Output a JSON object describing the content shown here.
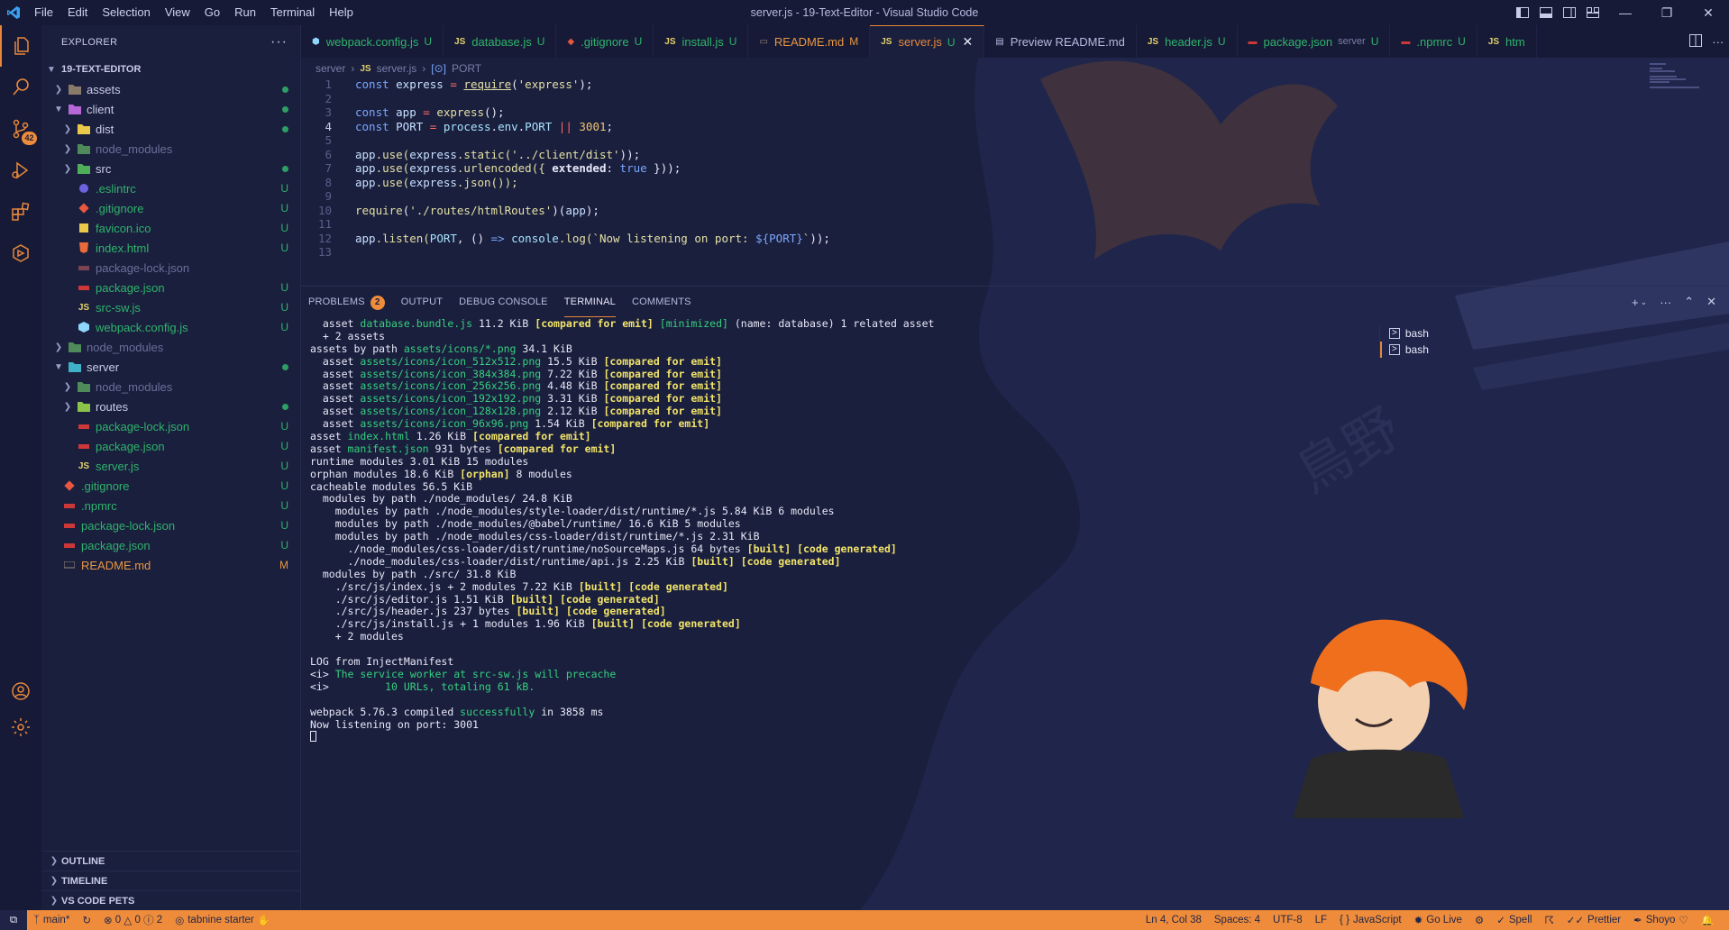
{
  "app": {
    "window_title": "server.js - 19-Text-Editor - Visual Studio Code"
  },
  "menu": [
    "File",
    "Edit",
    "Selection",
    "View",
    "Go",
    "Run",
    "Terminal",
    "Help"
  ],
  "activity": {
    "source_control_badge": "42"
  },
  "sidebar": {
    "title": "EXPLORER",
    "more": "···",
    "root": "19-TEXT-EDITOR",
    "items": [
      {
        "label": "assets",
        "status": "dot"
      },
      {
        "label": "client",
        "status": "dot"
      },
      {
        "label": "dist",
        "status": "dot"
      },
      {
        "label": "node_modules",
        "status": ""
      },
      {
        "label": "src",
        "status": "dot"
      },
      {
        "label": ".eslintrc",
        "status": "U"
      },
      {
        "label": ".gitignore",
        "status": "U"
      },
      {
        "label": "favicon.ico",
        "status": "U"
      },
      {
        "label": "index.html",
        "status": "U"
      },
      {
        "label": "package-lock.json",
        "status": ""
      },
      {
        "label": "package.json",
        "status": "U"
      },
      {
        "label": "src-sw.js",
        "status": "U"
      },
      {
        "label": "webpack.config.js",
        "status": "U"
      },
      {
        "label": "node_modules",
        "status": ""
      },
      {
        "label": "server",
        "status": "dot"
      },
      {
        "label": "node_modules",
        "status": ""
      },
      {
        "label": "routes",
        "status": "dot"
      },
      {
        "label": "package-lock.json",
        "status": "U"
      },
      {
        "label": "package.json",
        "status": "U"
      },
      {
        "label": "server.js",
        "status": "U"
      },
      {
        "label": ".gitignore",
        "status": "U"
      },
      {
        "label": ".npmrc",
        "status": "U"
      },
      {
        "label": "package-lock.json",
        "status": "U"
      },
      {
        "label": "package.json",
        "status": "U"
      },
      {
        "label": "README.md",
        "status": "M"
      }
    ],
    "sections": [
      "OUTLINE",
      "TIMELINE",
      "VS CODE PETS"
    ]
  },
  "tabs": [
    {
      "label": "webpack.config.js",
      "icon": "webpack-icon",
      "status": "U"
    },
    {
      "label": "database.js",
      "icon": "js-icon",
      "status": "U"
    },
    {
      "label": ".gitignore",
      "icon": "git-icon",
      "status": "U"
    },
    {
      "label": "install.js",
      "icon": "js-icon",
      "status": "U"
    },
    {
      "label": "README.md",
      "icon": "markdown-icon",
      "status": "M"
    },
    {
      "label": "server.js",
      "icon": "js-icon",
      "status": "U"
    },
    {
      "label": "Preview README.md",
      "icon": "preview-icon",
      "status": ""
    },
    {
      "label": "header.js",
      "icon": "js-icon",
      "status": "U"
    },
    {
      "label": "package.json",
      "icon": "npm-icon",
      "status": "U",
      "desc": "server"
    },
    {
      "label": ".npmrc",
      "icon": "npm-icon",
      "status": "U"
    },
    {
      "label": "htm",
      "icon": "js-icon",
      "status": ""
    }
  ],
  "breadcrumb": [
    "server",
    "server.js",
    "PORT"
  ],
  "code": {
    "line_numbers": [
      "1",
      "2",
      "3",
      "4",
      "5",
      "6",
      "7",
      "8",
      "9",
      "10",
      "11",
      "12",
      "13"
    ],
    "lines": {
      "l1_a": "const ",
      "l1_b": "express",
      "l1_c": " = ",
      "l1_d": "require",
      "l1_e": "(",
      "l1_f": "'express'",
      "l1_g": ");",
      "l3_a": "const ",
      "l3_b": "app",
      "l3_c": " = ",
      "l3_d": "express",
      "l3_e": "();",
      "l4_a": "const ",
      "l4_b": "PORT",
      "l4_c": " = ",
      "l4_d": "process",
      "l4_e": ".",
      "l4_f": "env",
      "l4_g": ".",
      "l4_h": "PORT",
      "l4_i": " || ",
      "l4_j": "3001",
      "l4_k": ";",
      "l6_a": "app",
      "l6_b": ".use(",
      "l6_c": "express",
      "l6_d": ".static(",
      "l6_e": "'../client/dist'",
      "l6_f": "));",
      "l7_a": "app",
      "l7_b": ".use(",
      "l7_c": "express",
      "l7_d": ".urlencoded({ ",
      "l7_e": "extended",
      "l7_f": ": ",
      "l7_g": "true",
      "l7_h": " }));",
      "l8_a": "app",
      "l8_b": ".use(",
      "l8_c": "express",
      "l8_d": ".json());",
      "l10_a": "require",
      "l10_b": "(",
      "l10_c": "'./routes/htmlRoutes'",
      "l10_d": ")(",
      "l10_e": "app",
      "l10_f": ");",
      "l12_a": "app",
      "l12_b": ".listen(",
      "l12_c": "PORT",
      "l12_d": ", () ",
      "l12_e": "=>",
      "l12_f": " console",
      "l12_g": ".log(",
      "l12_h": "`Now listening on port: ",
      "l12_i": "${PORT}",
      "l12_j": "`",
      "l12_k": "));"
    }
  },
  "panel": {
    "tabs": [
      "PROBLEMS",
      "OUTPUT",
      "DEBUG CONSOLE",
      "TERMINAL",
      "COMMENTS"
    ],
    "problems_count": "2",
    "terminals": [
      "bash",
      "bash"
    ]
  },
  "terminal": {
    "t1": [
      "  asset ",
      "database.bundle.js",
      " 11.2 KiB ",
      "[compared for emit]",
      " ",
      "[minimized]",
      " (name: database) 1 related asset"
    ],
    "t2": "  + 2 assets",
    "t3": [
      "assets by path ",
      "assets/icons/*.png",
      " 34.1 KiB"
    ],
    "icons": [
      [
        "  asset ",
        "assets/icons/icon_512x512.png",
        " 15.5 KiB ",
        "[compared for emit]"
      ],
      [
        "  asset ",
        "assets/icons/icon_384x384.png",
        " 7.22 KiB ",
        "[compared for emit]"
      ],
      [
        "  asset ",
        "assets/icons/icon_256x256.png",
        " 4.48 KiB ",
        "[compared for emit]"
      ],
      [
        "  asset ",
        "assets/icons/icon_192x192.png",
        " 3.31 KiB ",
        "[compared for emit]"
      ],
      [
        "  asset ",
        "assets/icons/icon_128x128.png",
        " 2.12 KiB ",
        "[compared for emit]"
      ],
      [
        "  asset ",
        "assets/icons/icon_96x96.png",
        " 1.54 KiB ",
        "[compared for emit]"
      ]
    ],
    "t10": [
      "asset ",
      "index.html",
      " 1.26 KiB ",
      "[compared for emit]"
    ],
    "t11": [
      "asset ",
      "manifest.json",
      " 931 bytes ",
      "[compared for emit]"
    ],
    "t12": "runtime modules 3.01 KiB 15 modules",
    "t13": [
      "orphan modules 18.6 KiB ",
      "[orphan]",
      " 8 modules"
    ],
    "t14": "cacheable modules 56.5 KiB",
    "t15": "  modules by path ./node_modules/ 24.8 KiB",
    "t16": "    modules by path ./node_modules/style-loader/dist/runtime/*.js 5.84 KiB 6 modules",
    "t17": "    modules by path ./node_modules/@babel/runtime/ 16.6 KiB 5 modules",
    "t18": "    modules by path ./node_modules/css-loader/dist/runtime/*.js 2.31 KiB",
    "t19": [
      "      ./node_modules/css-loader/dist/runtime/noSourceMaps.js 64 bytes ",
      "[built]",
      " ",
      "[code generated]"
    ],
    "t20": [
      "      ./node_modules/css-loader/dist/runtime/api.js 2.25 KiB ",
      "[built]",
      " ",
      "[code generated]"
    ],
    "t21": "  modules by path ./src/ 31.8 KiB",
    "t22": [
      "    ./src/js/index.js + 2 modules 7.22 KiB ",
      "[built]",
      " ",
      "[code generated]"
    ],
    "t23": [
      "    ./src/js/editor.js 1.51 KiB ",
      "[built]",
      " ",
      "[code generated]"
    ],
    "t24": [
      "    ./src/js/header.js 237 bytes ",
      "[built]",
      " ",
      "[code generated]"
    ],
    "t25": [
      "    ./src/js/install.js + 1 modules 1.96 KiB ",
      "[built]",
      " ",
      "[code generated]"
    ],
    "t26": "    + 2 modules",
    "t28": "LOG from InjectManifest",
    "t29": [
      "<i> ",
      "The service worker at src-sw.js will precache"
    ],
    "t30": [
      "<i>         ",
      "10 URLs, totaling 61 kB."
    ],
    "t32": [
      "webpack 5.76.3 compiled ",
      "successfully",
      " in 3858 ms"
    ],
    "t33": "Now listening on port: 3001"
  },
  "statusbar": {
    "branch": "main*",
    "errors": "0",
    "warnings": "0",
    "info": "2",
    "tabnine": "tabnine starter",
    "position": "Ln 4, Col 38",
    "spaces": "Spaces: 4",
    "encoding": "UTF-8",
    "eol": "LF",
    "language": "JavaScript",
    "golive": "Go Live",
    "spell": "Spell",
    "prettier": "Prettier",
    "theme": "Shoyo"
  },
  "colors": {
    "accent": "#ee8c3b",
    "background": "#1a1f3d",
    "git_untracked": "#2fb36b",
    "git_modified": "#e99640"
  }
}
